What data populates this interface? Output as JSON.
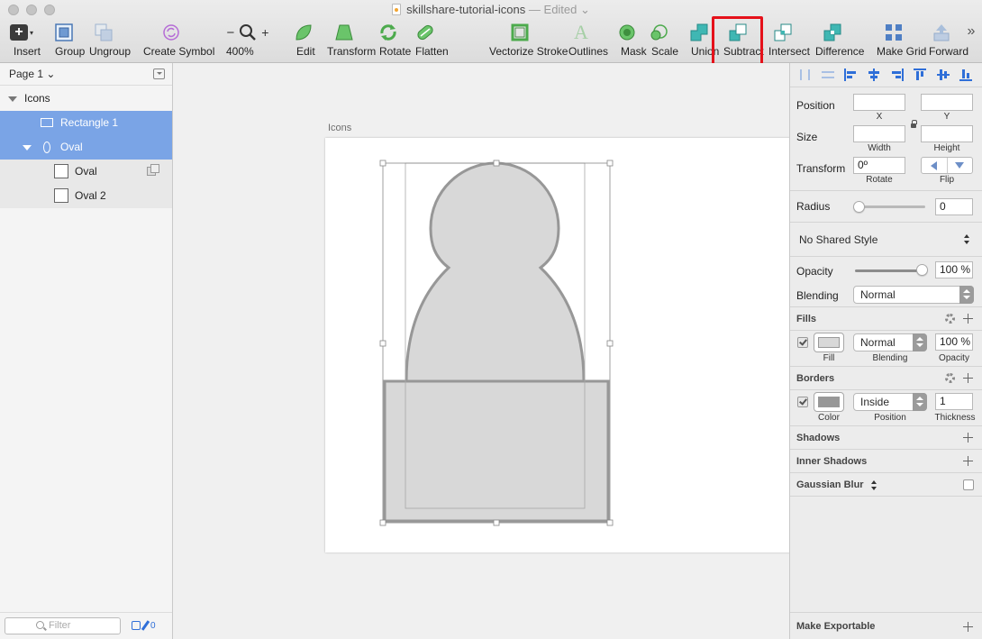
{
  "window": {
    "title": "skillshare-tutorial-icons",
    "status": "— Edited",
    "status_caret": "⌄"
  },
  "toolbar": {
    "insert": "Insert",
    "group": "Group",
    "ungroup": "Ungroup",
    "create_symbol": "Create Symbol",
    "zoom_minus": "−",
    "zoom_plus": "+",
    "zoom_value": "400%",
    "edit": "Edit",
    "transform": "Transform",
    "rotate": "Rotate",
    "flatten": "Flatten",
    "vectorize_stroke": "Vectorize Stroke",
    "outlines": "Outlines",
    "mask": "Mask",
    "scale": "Scale",
    "union": "Union",
    "subtract": "Subtract",
    "intersect": "Intersect",
    "difference": "Difference",
    "make_grid": "Make Grid",
    "forward": "Forward",
    "overflow": "»",
    "highlight_color": "#e5111a"
  },
  "sidebar": {
    "page_label": "Page 1 ⌄",
    "layers": [
      {
        "label": "Icons"
      },
      {
        "label": "Rectangle 1"
      },
      {
        "label": "Oval"
      },
      {
        "label": "Oval"
      },
      {
        "label": "Oval 2"
      }
    ],
    "filter_placeholder": "Filter",
    "filter_count": "0",
    "selection_color": "#7aa4e6"
  },
  "canvas": {
    "artboard_name": "Icons",
    "shape_fill": "#d8d8d8",
    "shape_stroke": "#979797"
  },
  "inspector": {
    "position_label": "Position",
    "x_value": "",
    "y_value": "",
    "x_label": "X",
    "y_label": "Y",
    "size_label": "Size",
    "width_value": "",
    "height_value": "",
    "width_label": "Width",
    "height_label": "Height",
    "transform_label": "Transform",
    "rotate_value": "0º",
    "rotate_label": "Rotate",
    "flip_label": "Flip",
    "radius_label": "Radius",
    "radius_value": "0",
    "shared_style": "No Shared Style",
    "opacity_label": "Opacity",
    "opacity_value": "100 %",
    "blending_label": "Blending",
    "blending_value": "Normal",
    "fills_header": "Fills",
    "fill_label": "Fill",
    "fill_blending_value": "Normal",
    "fill_blending_label": "Blending",
    "fill_opacity_value": "100 %",
    "fill_opacity_label": "Opacity",
    "borders_header": "Borders",
    "border_color_label": "Color",
    "border_position_value": "Inside",
    "border_position_label": "Position",
    "border_thickness_value": "1",
    "border_thickness_label": "Thickness",
    "shadows_header": "Shadows",
    "inner_shadows_header": "Inner Shadows",
    "gaussian_blur_header": "Gaussian Blur",
    "make_exportable": "Make Exportable",
    "fill_swatch_color": "#d8d8d8",
    "border_swatch_color": "#979797"
  }
}
